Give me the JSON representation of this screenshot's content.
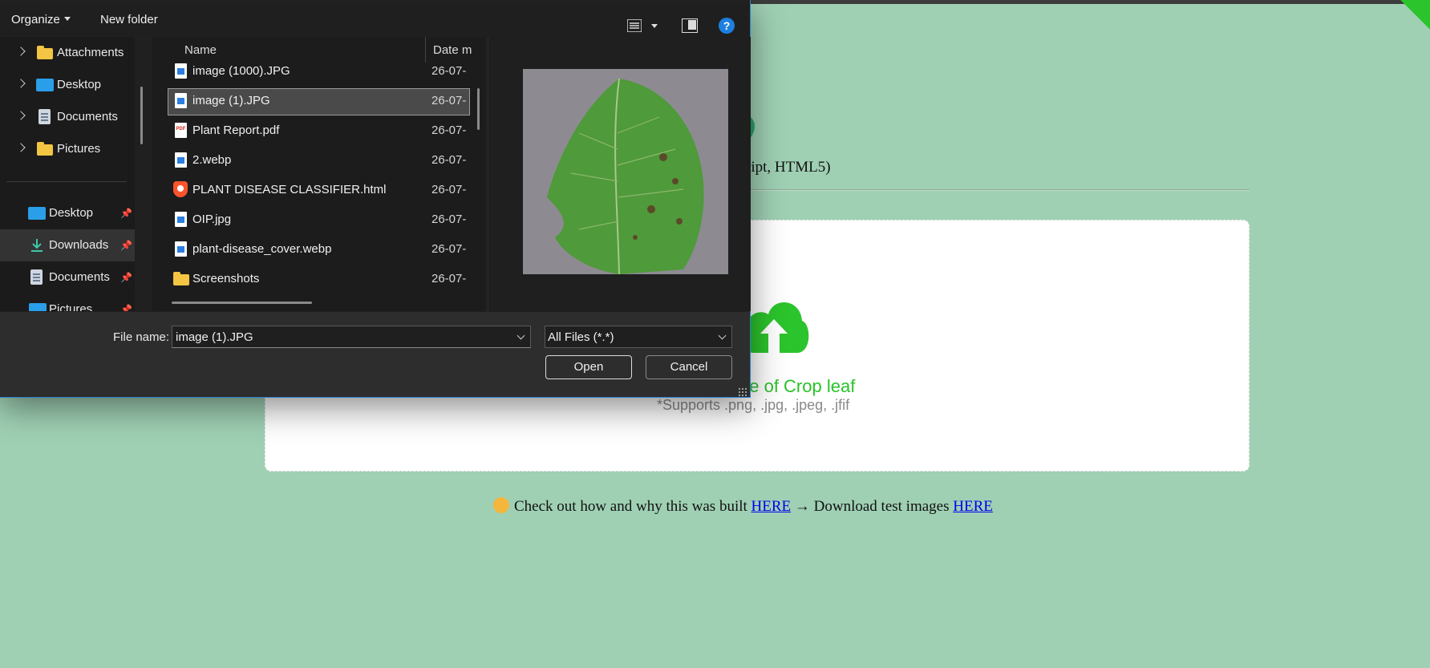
{
  "page": {
    "subtitle_fragment": "ript, HTML5)",
    "upload_title_fragment": "ge of Crop leaf",
    "upload_hint": "*Supports .png, .jpg, .jpeg, .jfif",
    "footer": {
      "text_before": "Check out how and why this was built",
      "link1": "HERE",
      "text_middle": " → Download test images ",
      "link2": "HERE"
    },
    "accent_color": "#2cc42c",
    "background_color": "#9fd0b4"
  },
  "dialog": {
    "toolbar": {
      "organize_label": "Organize",
      "new_folder_label": "New folder",
      "help_label": "?"
    },
    "nav": {
      "tree_items": [
        {
          "label": "Attachments",
          "icon": "folder-icon"
        },
        {
          "label": "Desktop",
          "icon": "desktop-icon"
        },
        {
          "label": "Documents",
          "icon": "documents-icon"
        },
        {
          "label": "Pictures",
          "icon": "folder-icon"
        }
      ],
      "quick_access": [
        {
          "label": "Desktop",
          "icon": "desktop-icon",
          "pinned": true
        },
        {
          "label": "Downloads",
          "icon": "download-icon",
          "pinned": true,
          "selected": true
        },
        {
          "label": "Documents",
          "icon": "documents-icon",
          "pinned": true
        },
        {
          "label": "Pictures",
          "icon": "pictures-icon",
          "pinned": true
        }
      ]
    },
    "columns": {
      "name": "Name",
      "date": "Date m"
    },
    "files": [
      {
        "name": "image (1000).JPG",
        "date": "26-07-",
        "type": "image"
      },
      {
        "name": "image (1).JPG",
        "date": "26-07-",
        "type": "image",
        "selected": true
      },
      {
        "name": "Plant Report.pdf",
        "date": "26-07-",
        "type": "pdf"
      },
      {
        "name": "2.webp",
        "date": "26-07-",
        "type": "image"
      },
      {
        "name": "PLANT DISEASE CLASSIFIER.html",
        "date": "26-07-",
        "type": "html"
      },
      {
        "name": "OIP.jpg",
        "date": "26-07-",
        "type": "image"
      },
      {
        "name": "plant-disease_cover.webp",
        "date": "26-07-",
        "type": "image"
      },
      {
        "name": "Screenshots",
        "date": "26-07-",
        "type": "folder"
      }
    ],
    "file_name_label": "File name:",
    "file_name_value": "image (1).JPG",
    "file_type_value": "All Files (*.*)",
    "open_label": "Open",
    "cancel_label": "Cancel",
    "preview": "green apple leaf with brown spots"
  }
}
